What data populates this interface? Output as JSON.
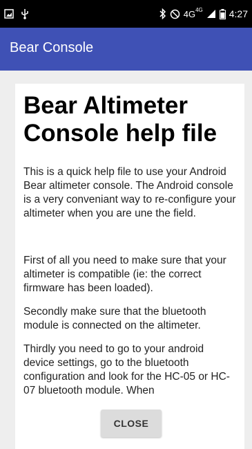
{
  "status_bar": {
    "network": "4G",
    "network_sup": "4G",
    "time": "4:27"
  },
  "app_bar": {
    "title": "Bear Console"
  },
  "doc": {
    "title": "Bear Altimeter Console help file",
    "paragraphs": [
      "This is a quick help file to use your Android Bear altimeter console. The Android console is a very conveniant way to re-configure your altimeter when you are une the field.",
      "First of all you need to make sure that your altimeter is compatible (ie: the correct firmware has been loaded).",
      "Secondly make sure that the bluetooth module is connected on the altimeter.",
      "Thirdly you need to go to your android device settings, go to the bluetooth configuration and look for the HC-05 or HC-07 bluetooth module. When"
    ]
  },
  "close_button": {
    "label": "CLOSE"
  }
}
